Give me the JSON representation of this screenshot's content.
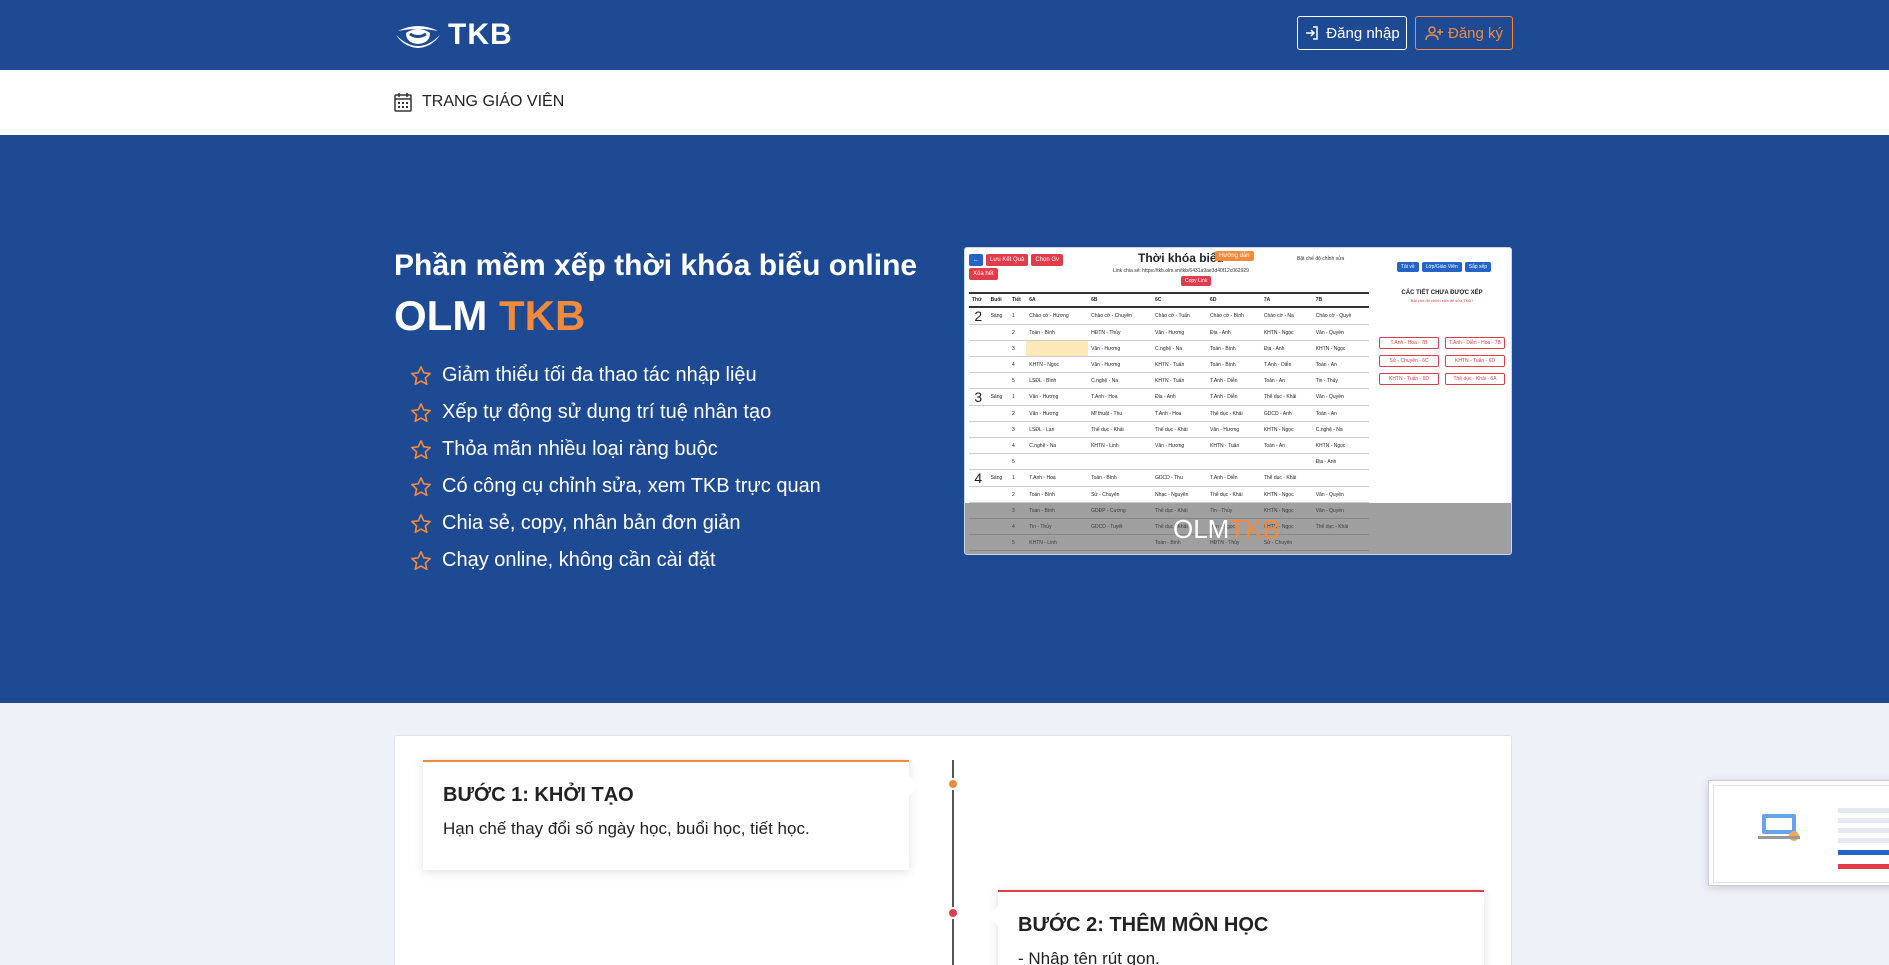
{
  "header": {
    "logo_text": "TKB",
    "login_label": "Đăng nhập",
    "register_label": "Đăng ký",
    "colors": {
      "primary": "#1e4a94",
      "accent": "#f28a3c"
    }
  },
  "subnav": {
    "teacher_page_label": "TRANG GIÁO VIÊN"
  },
  "hero": {
    "title": "Phần mềm xếp thời khóa biểu online",
    "brand_main": "OLM",
    "brand_accent": "TKB",
    "features": [
      "Giảm thiểu tối đa thao tác nhập liệu",
      "Xếp tự động sử dụng trí tuệ nhân tạo",
      "Thỏa mãn nhiều loại ràng buộc",
      "Có công cụ chỉnh sửa, xem TKB trực quan",
      "Chia sẻ, copy, nhân bản đơn giản",
      "Chạy online, không cần cài đặt"
    ]
  },
  "preview": {
    "title": "Thời khóa biểu",
    "tag": "Hướng dẫn",
    "toolbar": [
      "←",
      "Lưu Kết Quả",
      "Chọn Gv",
      "Xóa hết"
    ],
    "link_text": "Link chia sẻ: https://tkb.olm.vn/tkb/6431a9ae3d40f12c062929",
    "copy_label": "Copy Link",
    "toggle_label": "Bật chế độ chỉnh sửa",
    "right_buttons": [
      "Tải về",
      "Lớp/Giáo Viên",
      "Sắp xếp"
    ],
    "columns": [
      "Thứ",
      "Buổi",
      "Tiết",
      "6A",
      "6B",
      "6C",
      "6D",
      "7A",
      "7B"
    ],
    "rows": [
      [
        "2",
        "Sáng",
        "1",
        "Chào cờ - Hương",
        "Chào cờ - Chuyên",
        "Chào cờ - Tuấn",
        "Chào cờ - Bình",
        "Chào cờ - Na",
        "Chào cờ - Quyề"
      ],
      [
        "",
        "",
        "2",
        "Toán - Bình",
        "HĐTN - Thủy",
        "Văn - Hương",
        "Địa - Anh",
        "KHTN - Ngọc",
        "Văn - Quyền"
      ],
      [
        "",
        "",
        "3",
        "",
        "Văn - Hương",
        "C.nghệ - Na",
        "Toán - Bình",
        "Địa - Anh",
        "KHTN - Ngọc"
      ],
      [
        "",
        "",
        "4",
        "KHTN - Ngọc",
        "Văn - Hương",
        "KHTN - Tuấn",
        "Toán - Bình",
        "T.Anh - Diễn",
        "Toán - An"
      ],
      [
        "",
        "",
        "5",
        "LSĐL - Bình",
        "C.nghệ - Na",
        "KHTN - Tuấn",
        "T.Anh - Diễn",
        "Toán - An",
        "Tin - Thủy"
      ],
      [
        "3",
        "Sáng",
        "1",
        "Văn - Hương",
        "T.Anh - Hoa",
        "Địa - Anh",
        "T.Anh - Diễn",
        "Thể dục - Khải",
        "Văn - Quyền"
      ],
      [
        "",
        "",
        "2",
        "Văn - Hương",
        "Mĩ thuật - Thu",
        "T.Anh - Hoa",
        "Thể dục - Khải",
        "GDCD - Anh",
        "Toán - An"
      ],
      [
        "",
        "",
        "3",
        "LSĐL - Lan",
        "Thể dục - Khải",
        "Thể dục - Khải",
        "Văn - Hương",
        "KHTN - Ngọc",
        "C.nghệ - Na"
      ],
      [
        "",
        "",
        "4",
        "C.nghệ - Na",
        "KHTN - Linh",
        "Văn - Hương",
        "KHTN - Tuấn",
        "Toán - An",
        "KHTN - Ngọc"
      ],
      [
        "",
        "",
        "5",
        "",
        "",
        "",
        "",
        "",
        "Địa - Anh"
      ],
      [
        "4",
        "Sáng",
        "1",
        "T.Anh - Hoa",
        "Toán - Bình",
        "GDCD - Thu",
        "T.Anh - Diễn",
        "Thể dục - Khải",
        ""
      ],
      [
        "",
        "",
        "2",
        "Toán - Bình",
        "Sử - Chuyên",
        "Nhạc - Nguyên",
        "Thể dục - Khải",
        "KHTN - Ngọc",
        "Văn - Quyền"
      ],
      [
        "",
        "",
        "3",
        "Toán - Bình",
        "GDĐP - Cường",
        "Thể dục - Khải",
        "Tin - Thủy",
        "KHTN - Ngọc",
        "Văn - Quyền"
      ],
      [
        "",
        "",
        "4",
        "Tin - Thủy",
        "GDCD - Tuyết",
        "Thể dục - Khải",
        "Văn - Ngọc",
        "KHTN - Ngọc",
        "Thể dục - Khải"
      ],
      [
        "",
        "",
        "5",
        "KHTN - Linh",
        "",
        "Toán - Bình",
        "HĐTN - Thủy",
        "Sử - Chuyên",
        ""
      ]
    ],
    "side_title": "CÁC TIẾT CHƯA ĐƯỢC XẾP",
    "side_subtitle": "Bật chế độ chỉnh sửa để sửa TKB !",
    "side_items": [
      "T.Anh - Hoa - 7B",
      "T.Anh - Diễn - Hoa - 7B",
      "Sử - Chuyên - 6C",
      "KHTN - Tuấn - 6D",
      "KHTN - Tuấn - 6D",
      "Thể dục - Khải - 6A"
    ],
    "watermark_main": "OLM",
    "watermark_accent": "TKB"
  },
  "steps": [
    {
      "title": "BƯỚC 1: KHỞI TẠO",
      "desc": "Hạn chế thay đổi số ngày học, buổi học, tiết học."
    },
    {
      "title": "BƯỚC 2: THÊM MÔN HỌC",
      "desc": "- Nhập tên rút gọn."
    }
  ]
}
